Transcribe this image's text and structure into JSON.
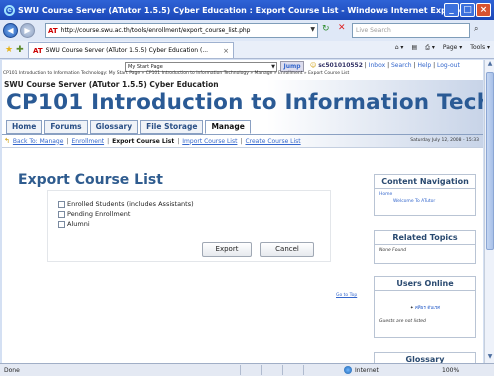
{
  "window": {
    "title": "SWU Course Server (ATutor 1.5.5) Cyber Education : Export Course List - Windows Internet Explorer",
    "minimize": "_",
    "maximize": "□",
    "close": "×"
  },
  "addressbar": {
    "url": "http://course.swu.ac.th/tools/enrollment/export_course_list.php",
    "search_placeholder": "Live Search",
    "back_glyph": "◀",
    "forward_glyph": "▶",
    "refresh_glyph": "↻",
    "stop_glyph": "✕",
    "search_glyph": "⌕",
    "dropdown_glyph": "▼"
  },
  "tabs": {
    "active_tab": "SWU Course Server (ATutor 1.5.5) Cyber Education (...",
    "close_glyph": "×",
    "toolbar": [
      "⌂ ▾",
      "▤",
      "⎙ ▾",
      "Page ▾",
      "Tools ▾"
    ]
  },
  "page": {
    "jump_select": "My Start Page",
    "jump_button": "Jump",
    "user": "sc501010552",
    "user_links": [
      "Inbox",
      "Search",
      "Help",
      "Log-out"
    ],
    "breadcrumb": "CP101 Introduction to Information Technology: My Start Page » CP101 Introduction to Information Technology » Manage » Enrollment » Export Course List",
    "server_name": "SWU Course Server (ATutor 1.5.5) Cyber Education",
    "course_title": "CP101 Introduction to Information Technology",
    "nav_tabs": [
      {
        "label": "Home",
        "active": false
      },
      {
        "label": "Forums",
        "active": false
      },
      {
        "label": "Glossary",
        "active": false
      },
      {
        "label": "File Storage",
        "active": false
      },
      {
        "label": "Manage",
        "active": true
      }
    ],
    "subnav": {
      "back": "Back To: Manage",
      "enrollment": "Enrollment",
      "current": "Export Course List",
      "import": "Import Course List",
      "create": "Create Course List",
      "separator": "|",
      "back_arrow": "↰"
    },
    "datestamp": "Saturday July 12, 2008 - 15:33",
    "heading": "Export Course List",
    "options": [
      {
        "label": "Enrolled Students (includes Assistants)",
        "checked": false
      },
      {
        "label": "Pending Enrollment",
        "checked": false
      },
      {
        "label": "Alumni",
        "checked": false
      }
    ],
    "export_button": "Export",
    "cancel_button": "Cancel",
    "goto_top": "Go to Top"
  },
  "sidebar": {
    "content_nav": {
      "title": "Content Navigation",
      "home": "Home",
      "welcome": "Welcome To ATutor"
    },
    "related": {
      "title": "Related Topics",
      "body": "None Found"
    },
    "online": {
      "title": "Users Online",
      "user": "ศศิธร ตันเรศ",
      "guests": "Guests are not listed"
    },
    "glossary": {
      "title": "Glossary"
    }
  },
  "statusbar": {
    "status": "Done",
    "zone": "Internet",
    "zoom": "100%"
  }
}
